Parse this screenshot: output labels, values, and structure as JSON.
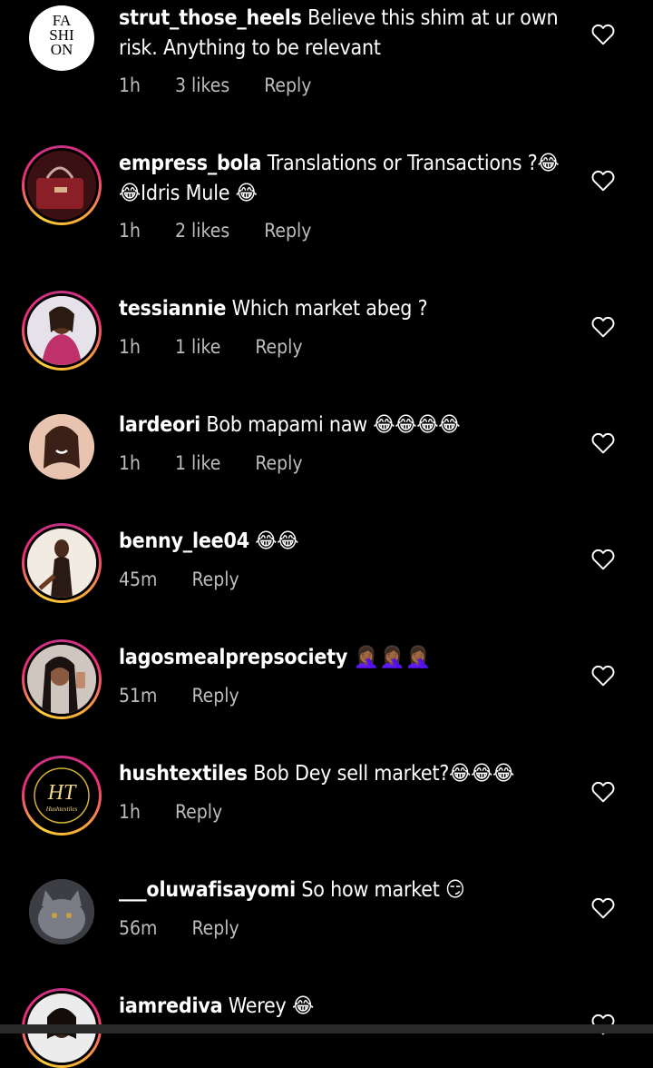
{
  "comments": [
    {
      "username": "strut_those_heels",
      "text": "Believe this shim at ur own risk. Anything to be relevant",
      "time": "1h",
      "likes": "3 likes",
      "reply": "Reply",
      "avatar": "fashion-logo-avatar",
      "story_ring": false
    },
    {
      "username": "empress_bola",
      "text": "Translations or Transactions ?😂😂Idris Mule 😂",
      "time": "1h",
      "likes": "2 likes",
      "reply": "Reply",
      "avatar": "handbag-avatar",
      "story_ring": true
    },
    {
      "username": "tessiannie",
      "text": "Which market abeg ?",
      "time": "1h",
      "likes": "1 like",
      "reply": "Reply",
      "avatar": "woman-portrait-avatar",
      "story_ring": true
    },
    {
      "username": "lardeori",
      "text": "Bob mapami naw 😂😂😂😂",
      "time": "1h",
      "likes": "1 like",
      "reply": "Reply",
      "avatar": "smiling-woman-avatar",
      "story_ring": false
    },
    {
      "username": "benny_lee04",
      "text": "😂😂",
      "time": "45m",
      "likes": "",
      "reply": "Reply",
      "avatar": "seated-woman-avatar",
      "story_ring": true
    },
    {
      "username": "lagosmealprepsociety",
      "text": "🤦🏾‍♀️🤦🏾‍♀️🤦🏾‍♀️",
      "time": "51m",
      "likes": "",
      "reply": "Reply",
      "avatar": "selfie-woman-avatar",
      "story_ring": true
    },
    {
      "username": "hushtextiles",
      "text": "Bob Dey sell market?😂😂😂",
      "time": "1h",
      "likes": "",
      "reply": "Reply",
      "avatar": "hushtextiles-logo-avatar",
      "avatar_text": "HT",
      "avatar_subtext": "Hushtextiles",
      "story_ring": true
    },
    {
      "username": "___oluwafisayomi",
      "text": "So how market 😏",
      "time": "56m",
      "likes": "",
      "reply": "Reply",
      "avatar": "cat-avatar",
      "story_ring": false
    },
    {
      "username": "iamrediva",
      "text": "Werey 😂",
      "time": "",
      "likes": "",
      "reply": "",
      "avatar": "woman-avatar",
      "story_ring": true
    }
  ],
  "logo_text": "FASHION",
  "colors": {
    "background": "#000000",
    "meta": "#bdbdbd",
    "ring_start": "#f9ce34",
    "ring_mid": "#ee2a7b",
    "ring_end": "#c13584"
  }
}
